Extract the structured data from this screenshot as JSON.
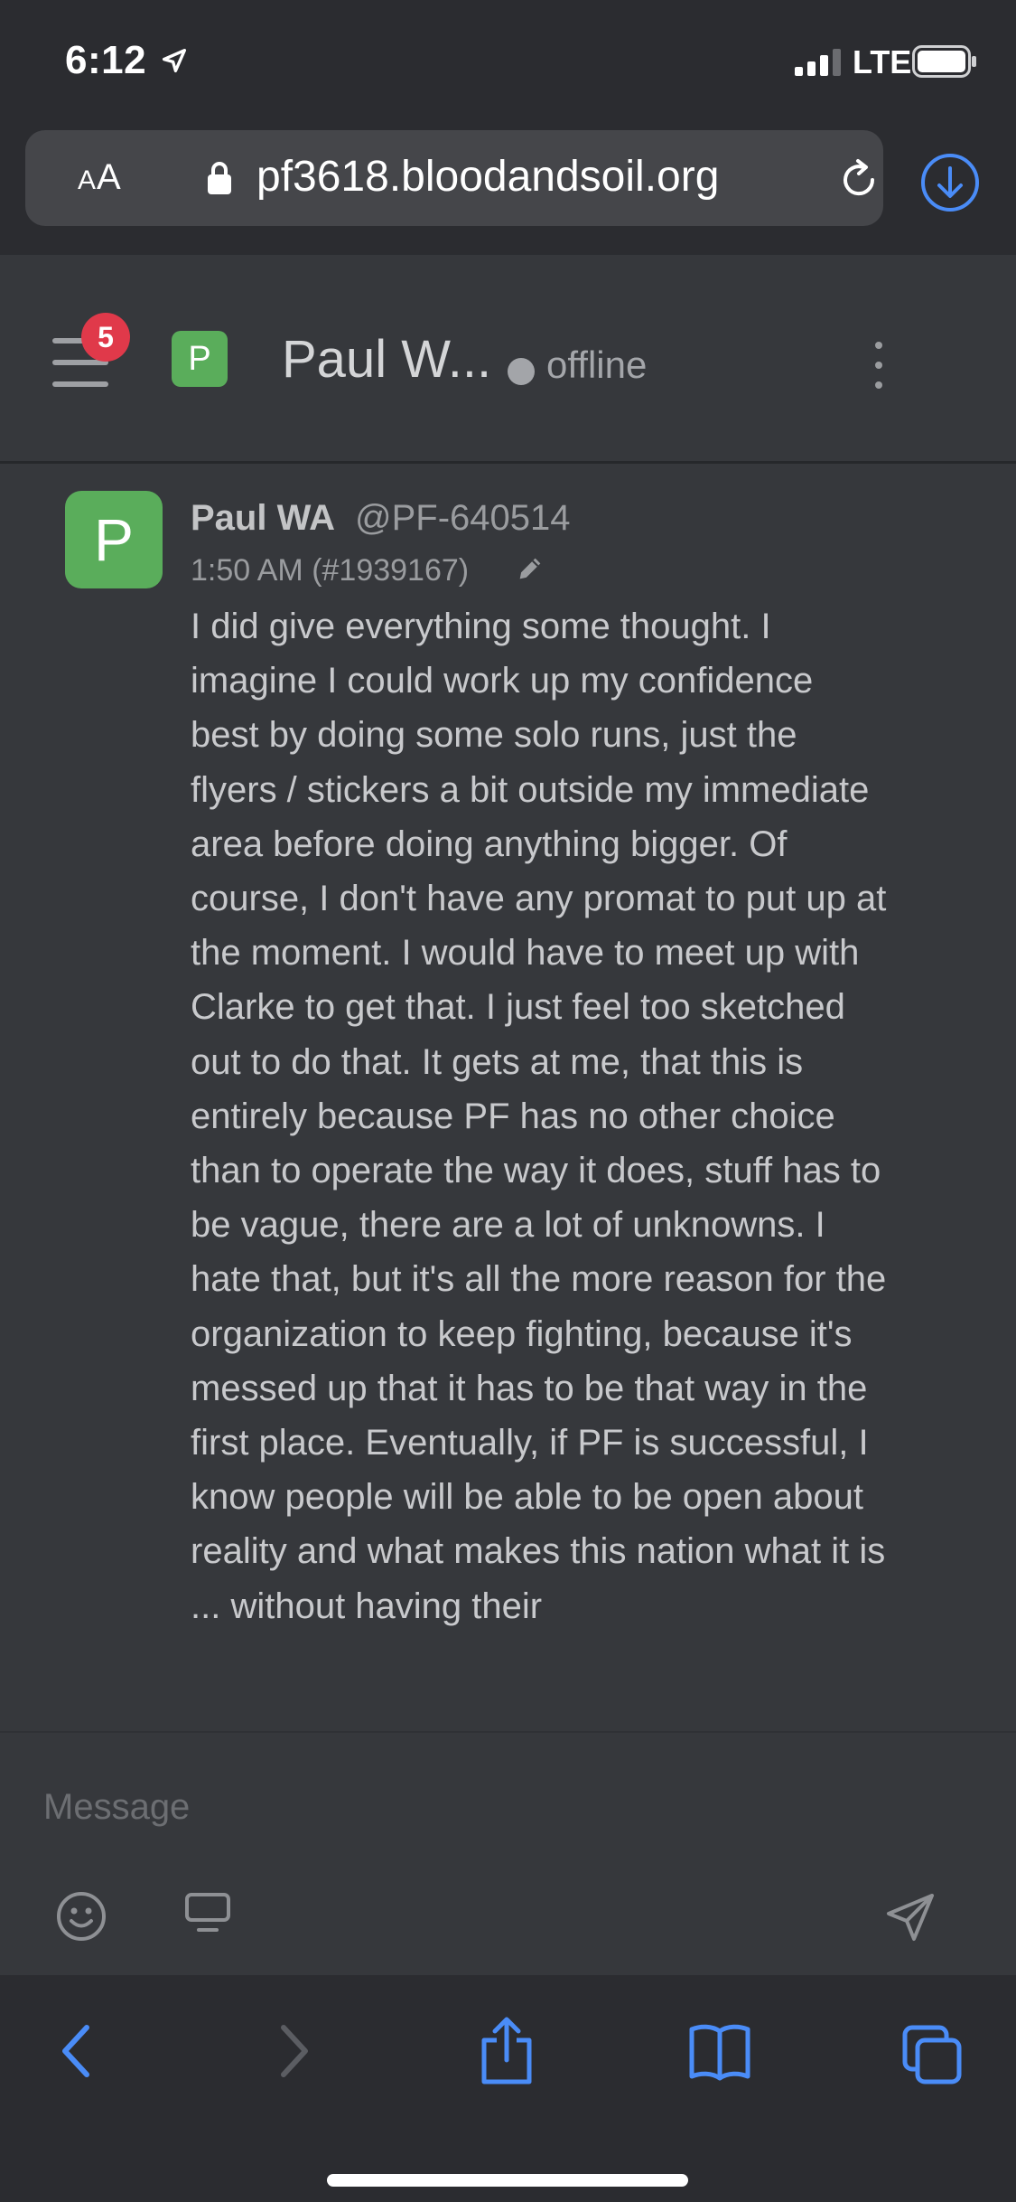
{
  "status_bar": {
    "time": "6:12",
    "network": "LTE"
  },
  "browser": {
    "text_size_small": "A",
    "text_size_large": "A",
    "url": "pf3618.bloodandsoil.org"
  },
  "chat_header": {
    "unread_count": "5",
    "avatar_letter": "P",
    "title": "Paul W...",
    "presence": "offline"
  },
  "message": {
    "avatar_letter": "P",
    "author": "Paul WA",
    "username": "@PF-640514",
    "meta": "1:50 AM (#1939167)",
    "body": "I did give everything some thought. I imagine I could work up my confidence best by doing some solo runs, just the flyers / stickers a bit outside my immediate area before doing anything bigger. Of course, I don't have any promat to put up at the moment. I would have to meet up with Clarke to get that. I just feel too sketched out to do that. It gets at me, that this is entirely because PF has no other choice than to operate the way it does, stuff has to be vague, there are a lot of unknowns. I hate that, but it's all the more reason for the organization to keep fighting, because it's messed up that it has to be that way in the first place. Eventually, if PF is successful, I know people will be able to be open about reality and what makes this nation what it is ... without having their"
  },
  "composer": {
    "placeholder": "Message"
  },
  "colors": {
    "accent_blue": "#4a8cf7",
    "avatar_green": "#5aad5b",
    "badge_red": "#e0394a",
    "panel_bg": "#36383c",
    "chrome_bg": "#2b2c30"
  },
  "icons": {
    "status": [
      "location-arrow-icon",
      "signal-bars-icon",
      "battery-icon"
    ],
    "browser": [
      "lock-icon",
      "reload-icon",
      "download-icon"
    ],
    "chat": [
      "hamburger-menu-icon",
      "kebab-menu-icon",
      "edit-pencil-icon",
      "emoji-icon",
      "screen-share-icon",
      "send-icon"
    ],
    "toolbar": [
      "back-icon",
      "forward-icon",
      "share-icon",
      "bookmarks-icon",
      "tabs-icon"
    ]
  }
}
